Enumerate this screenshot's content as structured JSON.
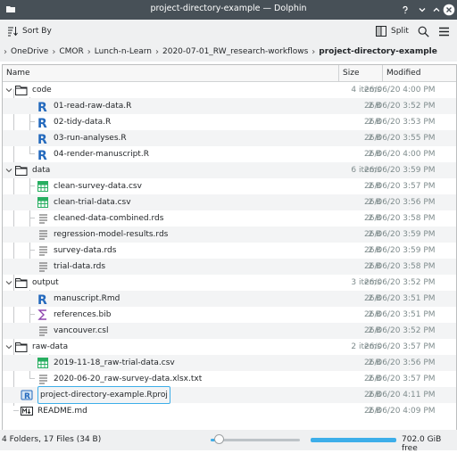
{
  "window": {
    "title": "project-directory-example — Dolphin"
  },
  "toolbar": {
    "sort_label": "Sort By",
    "split_label": "Split"
  },
  "breadcrumb": [
    "OneDrive",
    "CMOR",
    "Lunch-n-Learn",
    "2020-07-01_RW_research-workflows",
    "project-directory-example"
  ],
  "columns": {
    "name": "Name",
    "size": "Size",
    "modified": "Modified"
  },
  "rows": [
    {
      "name": "code",
      "size": "4 items",
      "modified": "26/06/20 4:00 PM"
    },
    {
      "name": "01-read-raw-data.R",
      "size": "2 B",
      "modified": "26/06/20 3:52 PM"
    },
    {
      "name": "02-tidy-data.R",
      "size": "2 B",
      "modified": "26/06/20 3:53 PM"
    },
    {
      "name": "03-run-analyses.R",
      "size": "2 B",
      "modified": "26/06/20 3:55 PM"
    },
    {
      "name": "04-render-manuscript.R",
      "size": "2 B",
      "modified": "26/06/20 4:00 PM"
    },
    {
      "name": "data",
      "size": "6 items",
      "modified": "26/06/20 3:59 PM"
    },
    {
      "name": "clean-survey-data.csv",
      "size": "2 B",
      "modified": "26/06/20 3:57 PM"
    },
    {
      "name": "clean-trial-data.csv",
      "size": "2 B",
      "modified": "26/06/20 3:56 PM"
    },
    {
      "name": "cleaned-data-combined.rds",
      "size": "2 B",
      "modified": "26/06/20 3:58 PM"
    },
    {
      "name": "regression-model-results.rds",
      "size": "2 B",
      "modified": "26/06/20 3:59 PM"
    },
    {
      "name": "survey-data.rds",
      "size": "2 B",
      "modified": "26/06/20 3:59 PM"
    },
    {
      "name": "trial-data.rds",
      "size": "2 B",
      "modified": "26/06/20 3:58 PM"
    },
    {
      "name": "output",
      "size": "3 items",
      "modified": "26/06/20 3:52 PM"
    },
    {
      "name": "manuscript.Rmd",
      "size": "2 B",
      "modified": "26/06/20 3:51 PM"
    },
    {
      "name": "references.bib",
      "size": "2 B",
      "modified": "26/06/20 3:51 PM"
    },
    {
      "name": "vancouver.csl",
      "size": "2 B",
      "modified": "26/06/20 3:52 PM"
    },
    {
      "name": "raw-data",
      "size": "2 items",
      "modified": "26/06/20 3:57 PM"
    },
    {
      "name": "2019-11-18_raw-trial-data.csv",
      "size": "2 B",
      "modified": "26/06/20 3:56 PM"
    },
    {
      "name": "2020-06-20_raw-survey-data.xlsx.txt",
      "size": "2 B",
      "modified": "26/06/20 3:57 PM"
    },
    {
      "name": "project-directory-example.Rproj",
      "size": "2 B",
      "modified": "26/06/20 4:11 PM"
    },
    {
      "name": "README.md",
      "size": "2 B",
      "modified": "26/06/20 4:09 PM"
    }
  ],
  "status": {
    "summary": "4 Folders, 17 Files (34 B)",
    "free_space": "702.0 GiB free",
    "zoom": 0.05
  },
  "colors": {
    "titlebar": "#475057",
    "accent": "#3daee9",
    "r_blue": "#2369bd",
    "csv_green": "#27ae60"
  }
}
